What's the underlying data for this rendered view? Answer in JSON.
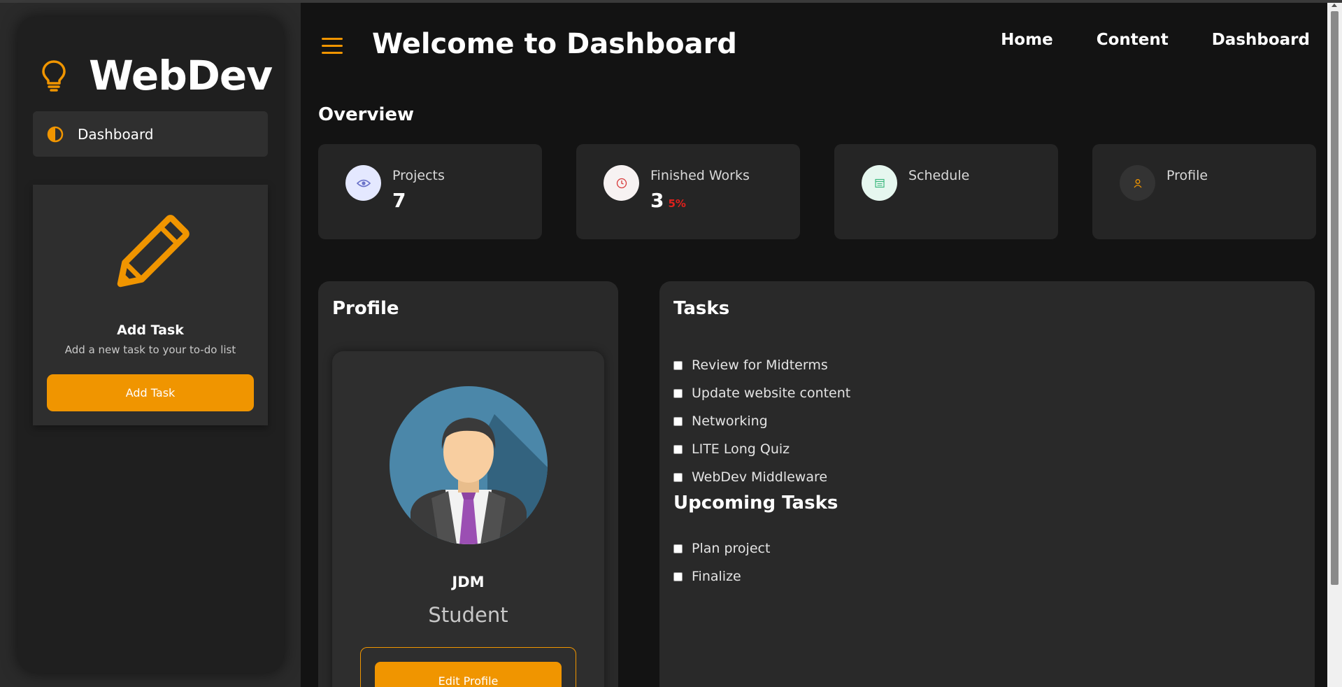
{
  "sidebar": {
    "brand": "WebDev",
    "nav": [
      {
        "label": "Dashboard",
        "icon": "half-circle-icon"
      }
    ],
    "task_card": {
      "title": "Add Task",
      "description": "Add a new task to your to-do list",
      "button_label": "Add Task"
    }
  },
  "header": {
    "title": "Welcome to Dashboard",
    "nav": [
      "Home",
      "Content",
      "Dashboard"
    ]
  },
  "overview": {
    "title": "Overview",
    "cards": [
      {
        "label": "Projects",
        "value": "7",
        "icon": "eye-icon"
      },
      {
        "label": "Finished Works",
        "value": "3",
        "badge": "5%",
        "icon": "clock-icon"
      },
      {
        "label": "Schedule",
        "value": "",
        "icon": "calendar-icon"
      },
      {
        "label": "Profile",
        "value": "",
        "icon": "user-icon"
      }
    ]
  },
  "profile": {
    "title": "Profile",
    "name": "JDM",
    "role": "Student",
    "edit_label": "Edit Profile"
  },
  "tasks": {
    "title": "Tasks",
    "items": [
      "Review for Midterms",
      "Update website content",
      "Networking",
      "LITE Long Quiz",
      "WebDev Middleware"
    ],
    "upcoming_title": "Upcoming Tasks",
    "upcoming": [
      "Plan project",
      "Finalize"
    ]
  },
  "colors": {
    "accent": "#f09500",
    "background": "#131313",
    "card": "#252525",
    "alert": "#e0201c"
  }
}
